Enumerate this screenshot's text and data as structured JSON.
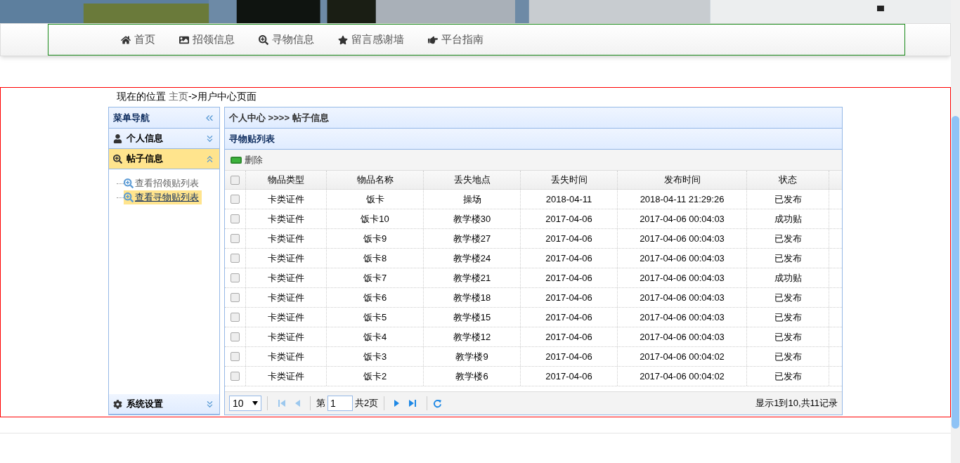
{
  "nav": [
    {
      "label": "首页"
    },
    {
      "label": "招领信息"
    },
    {
      "label": "寻物信息"
    },
    {
      "label": "留言感谢墙"
    },
    {
      "label": "平台指南"
    }
  ],
  "breadcrumb": {
    "prefix": "现在的位置",
    "link": "主页",
    "rest": "->用户中心页面"
  },
  "sidebar": {
    "title": "菜单导航",
    "sections": [
      {
        "label": "个人信息",
        "expanded": false
      },
      {
        "label": "帖子信息",
        "expanded": true,
        "children": [
          {
            "label": "查看招领贴列表",
            "selected": false
          },
          {
            "label": "查看寻物贴列表",
            "selected": true
          }
        ]
      },
      {
        "label": "系统设置",
        "expanded": false
      }
    ]
  },
  "panel": {
    "title": "个人中心 >>>> 帖子信息",
    "subtitle": "寻物贴列表",
    "delete_button": "删除"
  },
  "table": {
    "select_all_checked": false,
    "columns": [
      "物品类型",
      "物品名称",
      "丢失地点",
      "丢失时间",
      "发布时间",
      "状态"
    ],
    "rows": [
      {
        "checked": false,
        "cells": [
          "卡类证件",
          "饭卡",
          "操场",
          "2018-04-11",
          "2018-04-11 21:29:26",
          "已发布"
        ]
      },
      {
        "checked": false,
        "cells": [
          "卡类证件",
          "饭卡10",
          "教学楼30",
          "2017-04-06",
          "2017-04-06 00:04:03",
          "成功贴"
        ]
      },
      {
        "checked": false,
        "cells": [
          "卡类证件",
          "饭卡9",
          "教学楼27",
          "2017-04-06",
          "2017-04-06 00:04:03",
          "已发布"
        ]
      },
      {
        "checked": false,
        "cells": [
          "卡类证件",
          "饭卡8",
          "教学楼24",
          "2017-04-06",
          "2017-04-06 00:04:03",
          "已发布"
        ]
      },
      {
        "checked": false,
        "cells": [
          "卡类证件",
          "饭卡7",
          "教学楼21",
          "2017-04-06",
          "2017-04-06 00:04:03",
          "成功贴"
        ]
      },
      {
        "checked": false,
        "cells": [
          "卡类证件",
          "饭卡6",
          "教学楼18",
          "2017-04-06",
          "2017-04-06 00:04:03",
          "已发布"
        ]
      },
      {
        "checked": false,
        "cells": [
          "卡类证件",
          "饭卡5",
          "教学楼15",
          "2017-04-06",
          "2017-04-06 00:04:03",
          "已发布"
        ]
      },
      {
        "checked": false,
        "cells": [
          "卡类证件",
          "饭卡4",
          "教学楼12",
          "2017-04-06",
          "2017-04-06 00:04:03",
          "已发布"
        ]
      },
      {
        "checked": false,
        "cells": [
          "卡类证件",
          "饭卡3",
          "教学楼9",
          "2017-04-06",
          "2017-04-06 00:04:02",
          "已发布"
        ]
      },
      {
        "checked": false,
        "cells": [
          "卡类证件",
          "饭卡2",
          "教学楼6",
          "2017-04-06",
          "2017-04-06 00:04:02",
          "已发布"
        ]
      }
    ]
  },
  "pager": {
    "page_size": "10",
    "page_label": "第",
    "page": "1",
    "total_pages": "共2页",
    "info": "显示1到10,共11记录"
  }
}
